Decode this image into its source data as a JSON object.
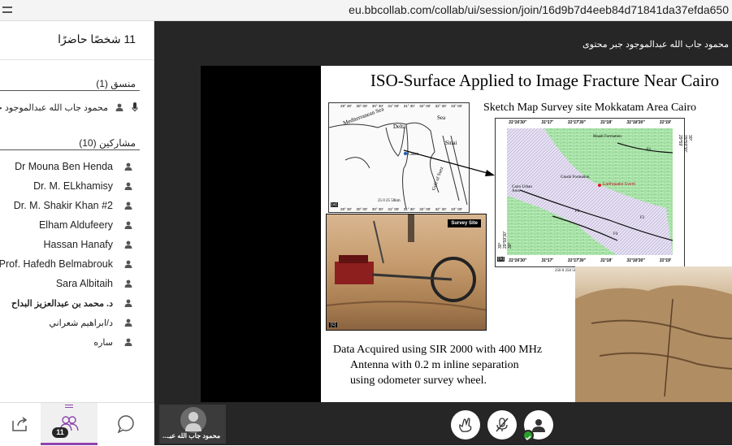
{
  "browser": {
    "url": "eu.bbcollab.com/collab/ui/session/join/16d9b7d4eeb84d71841da37efda650"
  },
  "panel": {
    "attendee_count": "11 شخصًا حاضرًا",
    "moderators_header": "منسق (1)",
    "moderators": [
      {
        "name": "محمود جاب الله عبدالموجود جبر"
      }
    ],
    "participants_header": "مشاركين (10)",
    "participants": [
      {
        "name": "Dr Mouna Ben Henda"
      },
      {
        "name": "Dr. M. ELkhamisy"
      },
      {
        "name": "Dr. M. Shakir Khan #2"
      },
      {
        "name": "Elham Aldufeery"
      },
      {
        "name": "Hassan Hanafy"
      },
      {
        "name": "Prof. Hafedh Belmabrouk"
      },
      {
        "name": "Sara Albitaih"
      },
      {
        "name": "د. محمد بن عبدالعزيز البداح"
      },
      {
        "name": "د/ابراهيم شعراني"
      },
      {
        "name": "ساره"
      }
    ],
    "footer": {
      "attendees_badge": "11"
    }
  },
  "stage": {
    "presenter_name": "محمود جاب الله عبدالموجود جبر محتوى",
    "video_tile_label": "محمود جاب الله عبـ...",
    "slide": {
      "title": "ISO-Surface Applied to Image Fracture Near Cairo",
      "sketch_title": "Sketch Map Survey site Mokkatam Area Cairo",
      "map_a": {
        "label": "[a]",
        "sea": "Mediterranean Sea",
        "delta": "Delta",
        "cairo": "Cairo",
        "sinai": "Sinai",
        "red_sea": "Sea",
        "scale": "25  0  25  50km",
        "gulf": "Gulf of Suez",
        "top_ticks": [
          "29° 30'",
          "30° 00'",
          "30° 30'",
          "31° 00'",
          "31° 30'",
          "32° 00'",
          "32° 30'",
          "33° 00'"
        ],
        "bottom_ticks": [
          "29° 30'",
          "30° 00'",
          "30° 30'",
          "31° 00'",
          "31° 30'",
          "32° 00'",
          "32° 30'",
          "33° 00'"
        ]
      },
      "map_b": {
        "label": "[b]",
        "maadi": "Maadi Formation",
        "giushi": "Giushi Formation",
        "quake": "Earthquake Event",
        "cairo_urban": "Cairo Urban Area",
        "top_ticks": [
          "31°16'30\"",
          "31°17'",
          "31°17'30\"",
          "31°18'",
          "31°18'30\"",
          "31°19'"
        ],
        "bottom_ticks": [
          "31°16'30\"",
          "31°17'",
          "31°17'30\"",
          "31°18'",
          "31°18'30\"",
          "31°19'"
        ],
        "left_ticks": [
          "30°",
          "29°59'30\"",
          "30°"
        ],
        "right_ticks": [
          "29°59'",
          "29°59'30\"",
          "30°"
        ],
        "faults": [
          "F1",
          "F2",
          "F3",
          "F4"
        ],
        "scale": "250   0    250   500   750",
        "scale_unit": "metre"
      },
      "photo_c": {
        "label": "[c]",
        "badge": "Survey Site"
      },
      "caption": [
        "Data Acquired using SIR 2000 with 400 MHz",
        "Antenna with 0.2 m inline separation",
        "using odometer survey wheel."
      ]
    }
  }
}
